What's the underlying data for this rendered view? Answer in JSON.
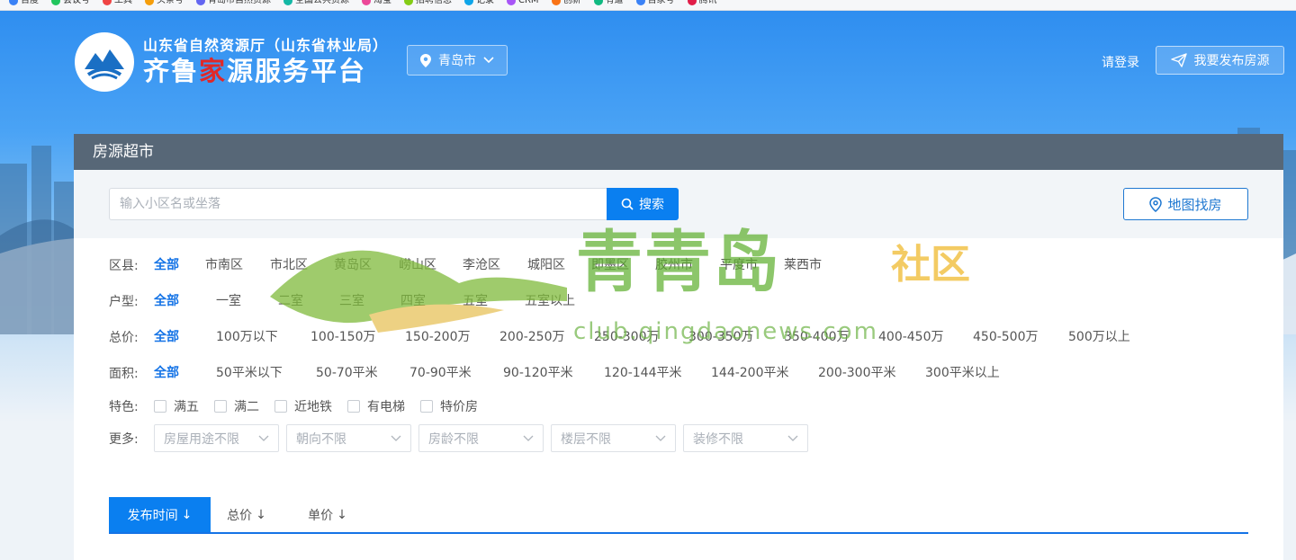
{
  "bookmarks": [
    "百度",
    "会议号",
    "工具",
    "头条号",
    "青岛市自然资源",
    "全国公共资源",
    "淘宝",
    "招聘信息",
    "记录",
    "CRM",
    "创新",
    "有道",
    "百家号",
    "腾讯"
  ],
  "header": {
    "org_name": "山东省自然资源厅（山东省林业局）",
    "platform_name_part1": "齐鲁",
    "platform_name_red": "家",
    "platform_name_part2": "源服务平台",
    "city": "青岛市",
    "login_label": "请登录",
    "publish_label": "我要发布房源"
  },
  "panel": {
    "title": "房源超市",
    "search": {
      "placeholder": "输入小区名或坐落",
      "button_label": "搜索"
    },
    "map_button_label": "地图找房"
  },
  "filters": {
    "district": {
      "label": "区县:",
      "options": [
        "全部",
        "市南区",
        "市北区",
        "黄岛区",
        "崂山区",
        "李沧区",
        "城阳区",
        "即墨区",
        "胶州市",
        "平度市",
        "莱西市"
      ],
      "selected": "全部"
    },
    "layout": {
      "label": "户型:",
      "options": [
        "全部",
        "一室",
        "二室",
        "三室",
        "四室",
        "五室",
        "五室以上"
      ],
      "selected": "全部"
    },
    "price": {
      "label": "总价:",
      "options": [
        "全部",
        "100万以下",
        "100-150万",
        "150-200万",
        "200-250万",
        "250-300万",
        "300-350万",
        "350-400万",
        "400-450万",
        "450-500万",
        "500万以上"
      ],
      "selected": "全部"
    },
    "area": {
      "label": "面积:",
      "options": [
        "全部",
        "50平米以下",
        "50-70平米",
        "70-90平米",
        "90-120平米",
        "120-144平米",
        "144-200平米",
        "200-300平米",
        "300平米以上"
      ],
      "selected": "全部"
    },
    "feature": {
      "label": "特色:",
      "options": [
        "满五",
        "满二",
        "近地铁",
        "有电梯",
        "特价房"
      ]
    },
    "more": {
      "label": "更多:",
      "selects": [
        "房屋用途不限",
        "朝向不限",
        "房龄不限",
        "楼层不限",
        "装修不限"
      ]
    }
  },
  "sort_tabs": [
    {
      "label": "发布时间",
      "arrow": "↓",
      "active": true
    },
    {
      "label": "总价",
      "arrow": "↓",
      "active": false
    },
    {
      "label": "单价",
      "arrow": "↓",
      "active": false
    }
  ],
  "watermark": {
    "title": "青青岛",
    "suffix": "社区",
    "url": "club.qingdaonews.com"
  },
  "colors": {
    "primary": "#0a7ff0",
    "active_text": "#1473e6",
    "brand_red": "#e02828"
  }
}
